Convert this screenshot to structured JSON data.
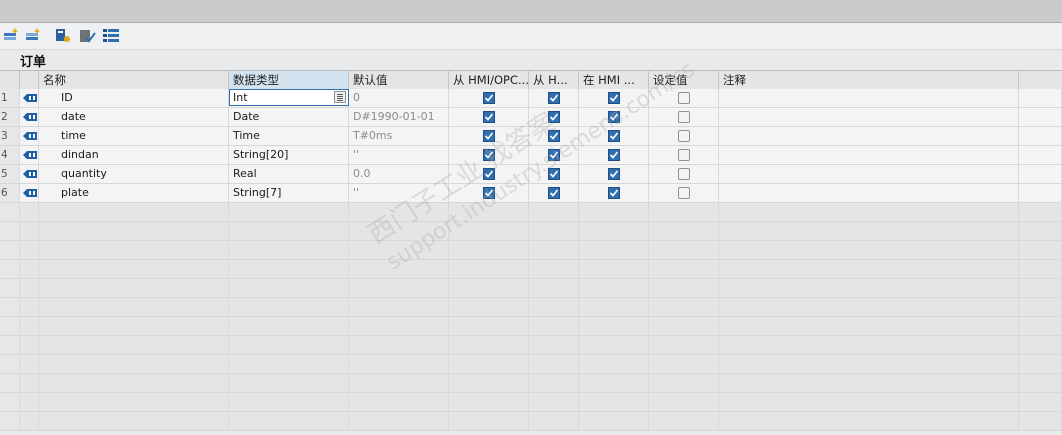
{
  "toolbar": {
    "buttons": [
      {
        "name": "insert-row-icon"
      },
      {
        "name": "add-row-icon"
      },
      {
        "name": "expand-all-icon"
      },
      {
        "name": "check-icon"
      },
      {
        "name": "detail-view-icon"
      }
    ]
  },
  "block": {
    "title": "订单"
  },
  "table": {
    "headers": [
      "名称",
      "数据类型",
      "默认值",
      "从 HMI/OPC...",
      "从 H...",
      "在 HMI ...",
      "设定值",
      "注释"
    ],
    "rows": [
      {
        "num": "1",
        "name": "ID",
        "type": "Int",
        "default": "0",
        "hmi_opc": true,
        "from_h": true,
        "in_hmi": true,
        "setpoint": false,
        "comment": ""
      },
      {
        "num": "2",
        "name": "date",
        "type": "Date",
        "default": "D#1990-01-01",
        "hmi_opc": true,
        "from_h": true,
        "in_hmi": true,
        "setpoint": false,
        "comment": ""
      },
      {
        "num": "3",
        "name": "time",
        "type": "Time",
        "default": "T#0ms",
        "hmi_opc": true,
        "from_h": true,
        "in_hmi": true,
        "setpoint": false,
        "comment": ""
      },
      {
        "num": "4",
        "name": "dindan",
        "type": "String[20]",
        "default": "''",
        "hmi_opc": true,
        "from_h": true,
        "in_hmi": true,
        "setpoint": false,
        "comment": ""
      },
      {
        "num": "5",
        "name": "quantity",
        "type": "Real",
        "default": "0.0",
        "hmi_opc": true,
        "from_h": true,
        "in_hmi": true,
        "setpoint": false,
        "comment": ""
      },
      {
        "num": "6",
        "name": "plate",
        "type": "String[7]",
        "default": "''",
        "hmi_opc": true,
        "from_h": true,
        "in_hmi": true,
        "setpoint": false,
        "comment": ""
      }
    ],
    "empty_rows": 12
  },
  "watermark": {
    "line1": "西门子工业 找答案",
    "line2": "support.industry.siemens.com/cs"
  },
  "colors": {
    "accent": "#2f6fae",
    "icon": "#1e5fa8"
  }
}
